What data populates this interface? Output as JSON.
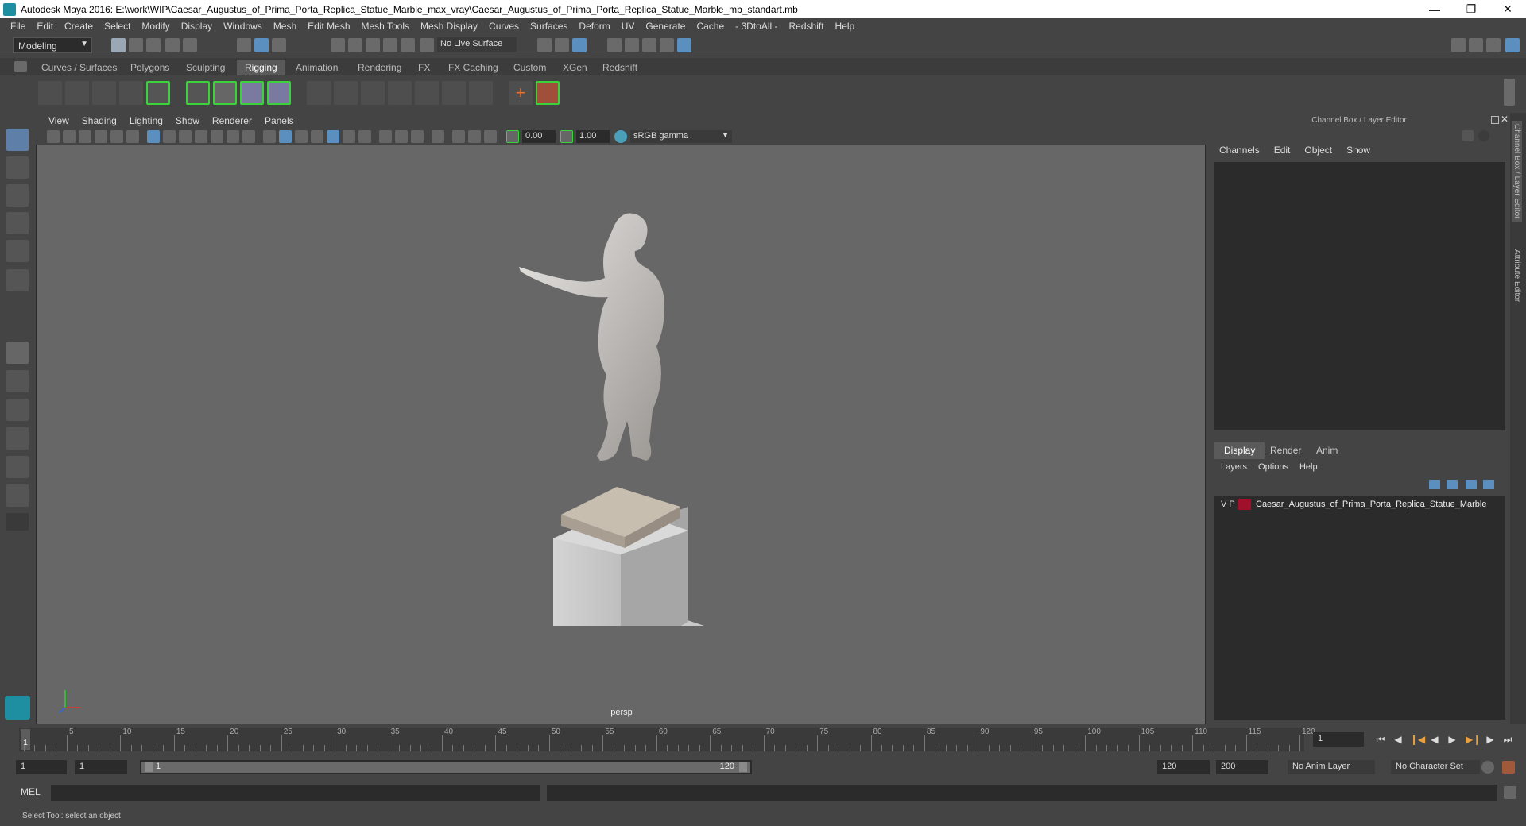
{
  "window": {
    "title": "Autodesk Maya 2016: E:\\work\\WIP\\Caesar_Augustus_of_Prima_Porta_Replica_Statue_Marble_max_vray\\Caesar_Augustus_of_Prima_Porta_Replica_Statue_Marble_mb_standart.mb",
    "controls": [
      "—",
      "❐",
      "✕"
    ]
  },
  "menubar": [
    "File",
    "Edit",
    "Create",
    "Select",
    "Modify",
    "Display",
    "Windows",
    "Mesh",
    "Edit Mesh",
    "Mesh Tools",
    "Mesh Display",
    "Curves",
    "Surfaces",
    "Deform",
    "UV",
    "Generate",
    "Cache",
    "- 3DtoAll -",
    "Redshift",
    "Help"
  ],
  "statusline": {
    "mode": "Modeling",
    "live_surface": "No Live Surface"
  },
  "shelf": {
    "tabs": [
      "Curves / Surfaces",
      "Polygons",
      "Sculpting",
      "Rigging",
      "Animation",
      "Rendering",
      "FX",
      "FX Caching",
      "Custom",
      "XGen",
      "Redshift"
    ],
    "active_tab": "Rigging"
  },
  "viewport": {
    "menu": [
      "View",
      "Shading",
      "Lighting",
      "Show",
      "Renderer",
      "Panels"
    ],
    "exposure": "0.00",
    "gamma": "1.00",
    "color_space": "sRGB gamma",
    "camera_label": "persp"
  },
  "channel_box": {
    "header": "Channel Box / Layer Editor",
    "menu": [
      "Channels",
      "Edit",
      "Object",
      "Show"
    ]
  },
  "layer_editor": {
    "tabs": [
      "Display",
      "Render",
      "Anim"
    ],
    "active_tab": "Display",
    "menu": [
      "Layers",
      "Options",
      "Help"
    ],
    "layers": [
      {
        "visible": "V",
        "playback": "P",
        "name": "Caesar_Augustus_of_Prima_Porta_Replica_Statue_Marble",
        "color": "#a0102a"
      }
    ]
  },
  "side_tabs": [
    "Channel Box / Layer Editor",
    "Attribute Editor"
  ],
  "timeline": {
    "ticks": [
      5,
      10,
      15,
      20,
      25,
      30,
      35,
      40,
      45,
      50,
      55,
      60,
      65,
      70,
      75,
      80,
      85,
      90,
      95,
      100,
      105,
      110,
      115,
      120
    ],
    "current_frame": "1",
    "frame_field": "1"
  },
  "range": {
    "start": "1",
    "playback_start": "1",
    "slider_start": "1",
    "slider_end": "120",
    "playback_end": "120",
    "end": "200",
    "anim_layer": "No Anim Layer",
    "character_set": "No Character Set"
  },
  "command_line": {
    "label": "MEL"
  },
  "help_line": "Select Tool: select an object"
}
